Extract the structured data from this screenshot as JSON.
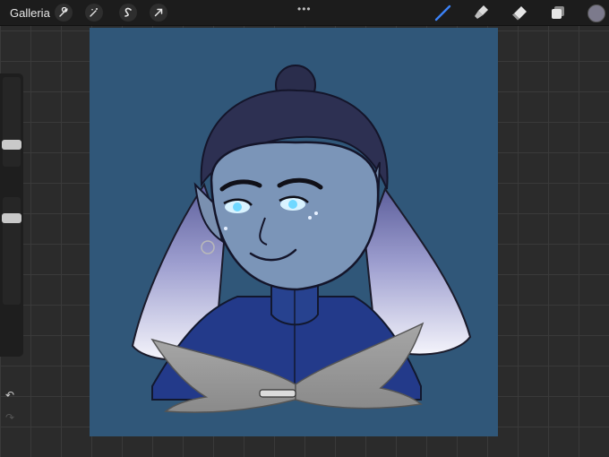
{
  "topbar": {
    "gallery_label": "Galleria",
    "left_tools": [
      "wrench-icon",
      "magic-wand-icon",
      "selection-s-icon",
      "transform-arrow-icon"
    ],
    "right_tools": [
      "brush-icon",
      "smudge-icon",
      "eraser-icon",
      "layers-icon"
    ],
    "active_tool": "brush-icon",
    "current_color": "#7c7a8c"
  },
  "sidebar": {
    "brush_size_level": 0.3,
    "opacity_level": 0.65,
    "undo_icon": "undo-arrow-icon",
    "redo_icon": "redo-arrow-icon"
  },
  "canvas": {
    "background": "#305779",
    "subject": "elf-portrait-artwork"
  },
  "colors": {
    "accent": "#3b82f6",
    "chrome": "#1c1c1c"
  }
}
